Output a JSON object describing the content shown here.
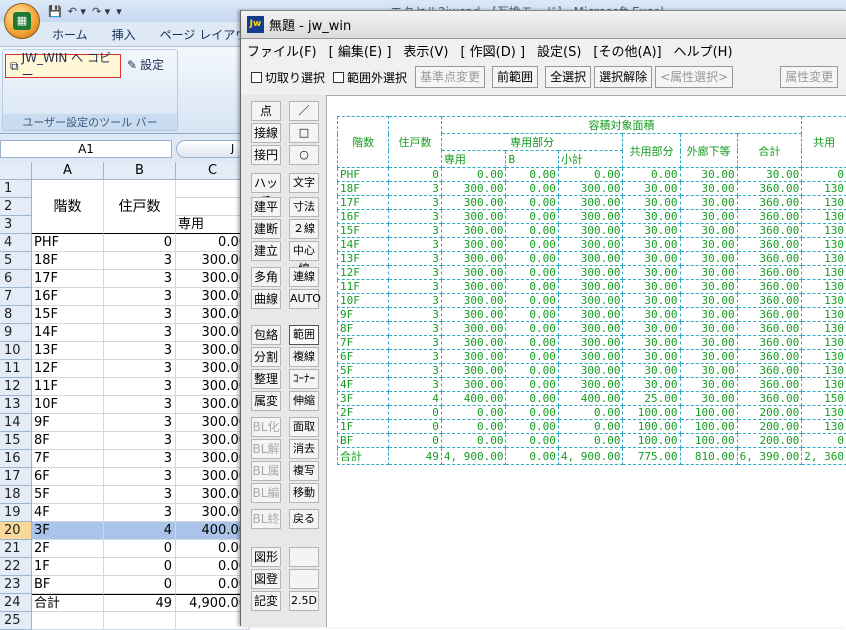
{
  "excel": {
    "title_text": "エクセル2jwcad - [互換モード] - Microsoft Excel",
    "quick_access": [
      "💾",
      "↶ ▾",
      "↷ ▾",
      "▾"
    ],
    "tabs": [
      "ホーム",
      "挿入",
      "ページ レイアウ"
    ],
    "ribbon": {
      "copy_button": "JW_WIN へ コピー",
      "settings_button": "設定",
      "group_label": "ユーザー設定のツール バー"
    },
    "name_box": "A1",
    "formula_fragment": "J",
    "columns": [
      "A",
      "B",
      "C"
    ],
    "header": {
      "kaisu": "階数",
      "jukosu": "住戸数",
      "senyo": "専用"
    },
    "rows": [
      {
        "n": "1",
        "a": "",
        "b": "",
        "c": ""
      },
      {
        "n": "2",
        "a": "",
        "b": "",
        "c": ""
      },
      {
        "n": "3",
        "a": "",
        "b": "",
        "c": ""
      },
      {
        "n": "4",
        "a": "PHF",
        "b": "0",
        "c": "0.00"
      },
      {
        "n": "5",
        "a": "18F",
        "b": "3",
        "c": "300.00"
      },
      {
        "n": "6",
        "a": "17F",
        "b": "3",
        "c": "300.00"
      },
      {
        "n": "7",
        "a": "16F",
        "b": "3",
        "c": "300.00"
      },
      {
        "n": "8",
        "a": "15F",
        "b": "3",
        "c": "300.00"
      },
      {
        "n": "9",
        "a": "14F",
        "b": "3",
        "c": "300.00"
      },
      {
        "n": "10",
        "a": "13F",
        "b": "3",
        "c": "300.00"
      },
      {
        "n": "11",
        "a": "12F",
        "b": "3",
        "c": "300.00"
      },
      {
        "n": "12",
        "a": "11F",
        "b": "3",
        "c": "300.00"
      },
      {
        "n": "13",
        "a": "10F",
        "b": "3",
        "c": "300.00"
      },
      {
        "n": "14",
        "a": "9F",
        "b": "3",
        "c": "300.00"
      },
      {
        "n": "15",
        "a": "8F",
        "b": "3",
        "c": "300.00"
      },
      {
        "n": "16",
        "a": "7F",
        "b": "3",
        "c": "300.00"
      },
      {
        "n": "17",
        "a": "6F",
        "b": "3",
        "c": "300.00"
      },
      {
        "n": "18",
        "a": "5F",
        "b": "3",
        "c": "300.00"
      },
      {
        "n": "19",
        "a": "4F",
        "b": "3",
        "c": "300.00"
      },
      {
        "n": "20",
        "a": "3F",
        "b": "4",
        "c": "400.00"
      },
      {
        "n": "21",
        "a": "2F",
        "b": "0",
        "c": "0.00"
      },
      {
        "n": "22",
        "a": "1F",
        "b": "0",
        "c": "0.00"
      },
      {
        "n": "23",
        "a": "BF",
        "b": "0",
        "c": "0.00"
      },
      {
        "n": "24",
        "a": "合計",
        "b": "49",
        "c": "4,900.00"
      },
      {
        "n": "25",
        "a": "",
        "b": "",
        "c": ""
      }
    ]
  },
  "jw": {
    "title": "無題 - jw_win",
    "menu": [
      "ファイル(F)",
      "[ 編集(E) ]",
      "表示(V)",
      "[ 作図(D) ]",
      "設定(S)",
      "[その他(A)]",
      "ヘルプ(H)"
    ],
    "toolbar": {
      "cut_select": "切取り選択",
      "outside_select": "範囲外選択",
      "base_change": "基準点変更",
      "prev_range": "前範囲",
      "select_all": "全選択",
      "deselect": "選択解除",
      "attr_select": "<属性選択>",
      "attr_change": "属性変更"
    },
    "left_col1": [
      "点",
      "接線",
      "接円",
      "ハッチ",
      "建平",
      "建断",
      "建立",
      "多角形",
      "曲線",
      "包絡",
      "分割",
      "整理",
      "属変",
      "BL化",
      "BL解",
      "BL属",
      "BL編",
      "BL終",
      "図形",
      "図登",
      "記変"
    ],
    "left_col2": [
      "／",
      "□",
      "○",
      "文字",
      "寸法",
      "２線",
      "中心線",
      "連線",
      "AUTO",
      "範囲",
      "複線",
      "ｺｰﾅｰ",
      "伸縮",
      "面取",
      "消去",
      "複写",
      "移動",
      "戻る",
      "",
      "",
      "2.5D"
    ],
    "table": {
      "title": "容積対象面積",
      "h_kaisu": "階数",
      "h_jukosu": "住戸数",
      "h_senyo_part": "専用部分",
      "h_senyo": "専用",
      "h_b": "B",
      "h_shokei": "小計",
      "h_kyoyo": "共用部分",
      "h_gairo": "外廊下等",
      "h_total": "合計",
      "h_kyoyo2": "共用",
      "rows": [
        [
          "PHF",
          "0",
          "0.00",
          "0.00",
          "0.00",
          "0.00",
          "30.00",
          "30.00",
          "0"
        ],
        [
          "18F",
          "3",
          "300.00",
          "0.00",
          "300.00",
          "30.00",
          "30.00",
          "360.00",
          "130"
        ],
        [
          "17F",
          "3",
          "300.00",
          "0.00",
          "300.00",
          "30.00",
          "30.00",
          "360.00",
          "130"
        ],
        [
          "16F",
          "3",
          "300.00",
          "0.00",
          "300.00",
          "30.00",
          "30.00",
          "360.00",
          "130"
        ],
        [
          "15F",
          "3",
          "300.00",
          "0.00",
          "300.00",
          "30.00",
          "30.00",
          "360.00",
          "130"
        ],
        [
          "14F",
          "3",
          "300.00",
          "0.00",
          "300.00",
          "30.00",
          "30.00",
          "360.00",
          "130"
        ],
        [
          "13F",
          "3",
          "300.00",
          "0.00",
          "300.00",
          "30.00",
          "30.00",
          "360.00",
          "130"
        ],
        [
          "12F",
          "3",
          "300.00",
          "0.00",
          "300.00",
          "30.00",
          "30.00",
          "360.00",
          "130"
        ],
        [
          "11F",
          "3",
          "300.00",
          "0.00",
          "300.00",
          "30.00",
          "30.00",
          "360.00",
          "130"
        ],
        [
          "10F",
          "3",
          "300.00",
          "0.00",
          "300.00",
          "30.00",
          "30.00",
          "360.00",
          "130"
        ],
        [
          "9F",
          "3",
          "300.00",
          "0.00",
          "300.00",
          "30.00",
          "30.00",
          "360.00",
          "130"
        ],
        [
          "8F",
          "3",
          "300.00",
          "0.00",
          "300.00",
          "30.00",
          "30.00",
          "360.00",
          "130"
        ],
        [
          "7F",
          "3",
          "300.00",
          "0.00",
          "300.00",
          "30.00",
          "30.00",
          "360.00",
          "130"
        ],
        [
          "6F",
          "3",
          "300.00",
          "0.00",
          "300.00",
          "30.00",
          "30.00",
          "360.00",
          "130"
        ],
        [
          "5F",
          "3",
          "300.00",
          "0.00",
          "300.00",
          "30.00",
          "30.00",
          "360.00",
          "130"
        ],
        [
          "4F",
          "3",
          "300.00",
          "0.00",
          "300.00",
          "30.00",
          "30.00",
          "360.00",
          "130"
        ],
        [
          "3F",
          "4",
          "400.00",
          "0.00",
          "400.00",
          "25.00",
          "30.00",
          "360.00",
          "150"
        ],
        [
          "2F",
          "0",
          "0.00",
          "0.00",
          "0.00",
          "100.00",
          "100.00",
          "200.00",
          "130"
        ],
        [
          "1F",
          "0",
          "0.00",
          "0.00",
          "0.00",
          "100.00",
          "100.00",
          "200.00",
          "130"
        ],
        [
          "BF",
          "0",
          "0.00",
          "0.00",
          "0.00",
          "100.00",
          "100.00",
          "200.00",
          "0"
        ],
        [
          "合計",
          "49",
          "4, 900.00",
          "0.00",
          "4, 900.00",
          "775.00",
          "810.00",
          "6, 390.00",
          "2, 360"
        ]
      ]
    }
  }
}
